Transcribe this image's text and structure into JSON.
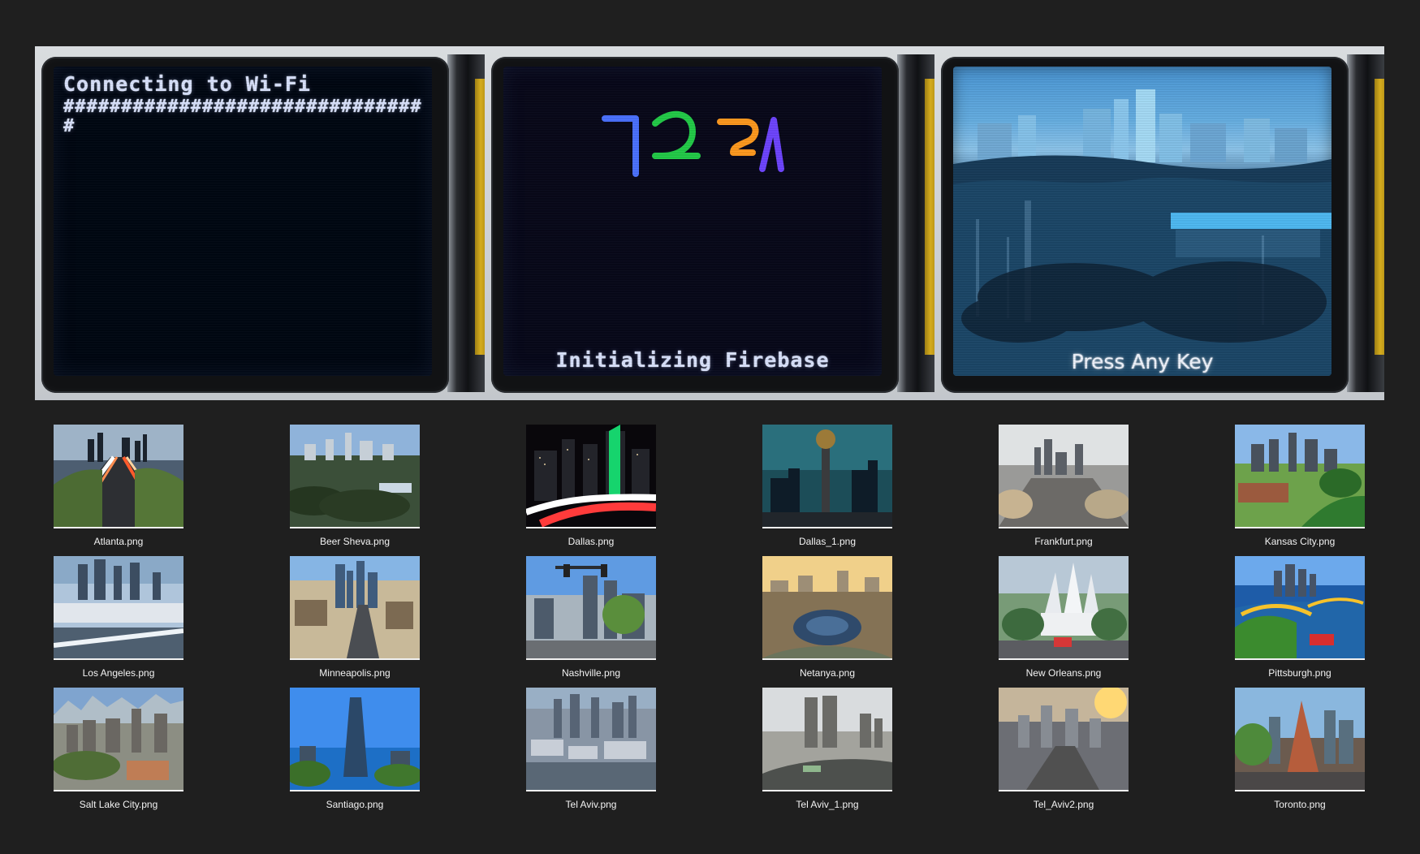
{
  "screens": {
    "wifi": {
      "title": "Connecting to Wi-Fi",
      "progress": "################################"
    },
    "firebase": {
      "label": "Initializing Firebase"
    },
    "ready": {
      "label": "Press Any Key"
    }
  },
  "thumbnails": [
    {
      "label": "Atlanta.png"
    },
    {
      "label": "Beer Sheva.png"
    },
    {
      "label": "Dallas.png"
    },
    {
      "label": "Dallas_1.png"
    },
    {
      "label": "Frankfurt.png"
    },
    {
      "label": "Kansas City.png"
    },
    {
      "label": "Los Angeles.png"
    },
    {
      "label": "Minneapolis.png"
    },
    {
      "label": "Nashville.png"
    },
    {
      "label": "Netanya.png"
    },
    {
      "label": "New Orleans.png"
    },
    {
      "label": "Pittsburgh.png"
    },
    {
      "label": "Salt Lake City.png"
    },
    {
      "label": "Santiago.png"
    },
    {
      "label": "Tel Aviv.png"
    },
    {
      "label": "Tel Aviv_1.png"
    },
    {
      "label": "Tel_Aviv2.png"
    },
    {
      "label": "Toronto.png"
    }
  ],
  "colors": {
    "background": "#1f1f1f",
    "label": "#f3f3f3",
    "screen_text": "#dbe4ff",
    "logo_blue": "#4b72ff",
    "logo_green": "#23cc48",
    "logo_orange": "#ff9a1f",
    "logo_purple": "#6e45ff"
  }
}
